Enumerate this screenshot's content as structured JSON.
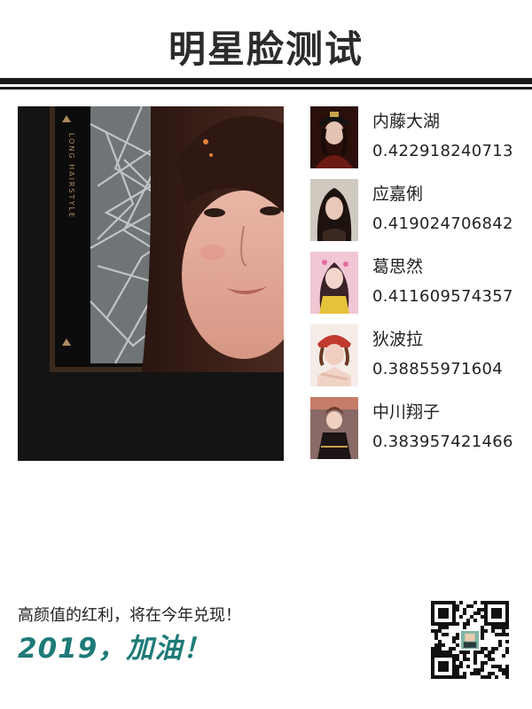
{
  "header": {
    "title": "明星脸测试"
  },
  "photo": {
    "watermark": "LONG HAIRSTYLE"
  },
  "matches": [
    {
      "name": "内藤大湖",
      "score": "0.422918240713",
      "thumb_color": "#3a1a14"
    },
    {
      "name": "应嘉俐",
      "score": "0.419024706842",
      "thumb_color": "#5a4a3a"
    },
    {
      "name": "葛思然",
      "score": "0.411609574357",
      "thumb_color": "#e9b8c8"
    },
    {
      "name": "狄波拉",
      "score": "0.38855971604",
      "thumb_color": "#f4e8e4"
    },
    {
      "name": "中川翔子",
      "score": "0.383957421466",
      "thumb_color": "#6a3a3a"
    }
  ],
  "footer": {
    "slogan": "高颜值的红利，将在今年兑现！",
    "motto": "2019，加油！",
    "motto_color": "#1e7a78"
  },
  "qr": {
    "icon": "qr-code-icon"
  }
}
